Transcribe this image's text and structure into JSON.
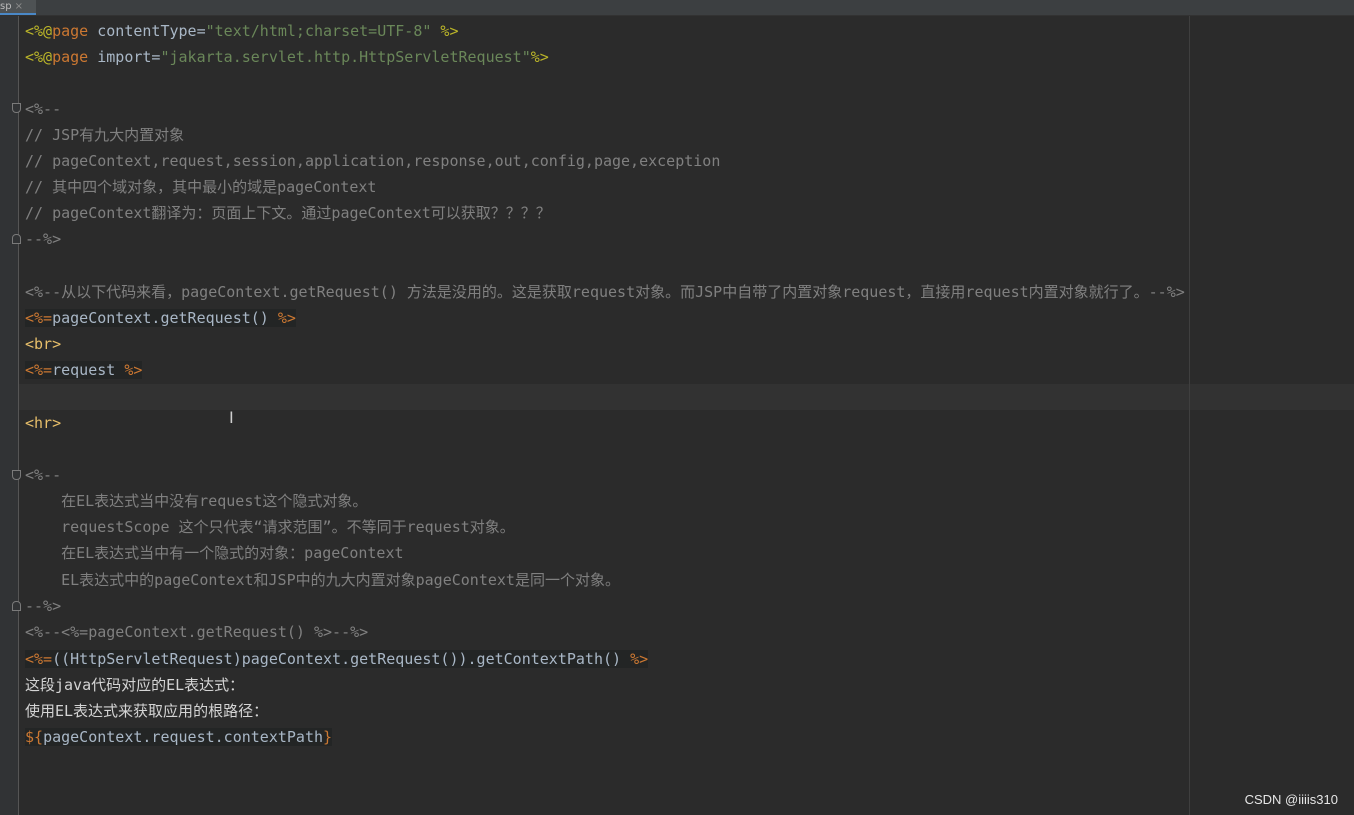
{
  "tab": {
    "label": "sp",
    "close": "×"
  },
  "code": {
    "l1": {
      "a": "<%@",
      "b": "page",
      "c": " contentType=",
      "d": "\"text/html;charset=UTF-8\"",
      "e": " %>"
    },
    "l2": {
      "a": "<%@",
      "b": "page",
      "c": " import=",
      "d": "\"jakarta.servlet.http.HttpServletRequest\"",
      "e": "%>"
    },
    "l4": "<%--",
    "l5": "// JSP有九大内置对象",
    "l6": "// pageContext,request,session,application,response,out,config,page,exception",
    "l7": "// 其中四个域对象，其中最小的域是pageContext",
    "l8": "// pageContext翻译为：页面上下文。通过pageContext可以获取？？？？",
    "l9": "--%>",
    "l11": "<%--从以下代码来看，pageContext.getRequest() 方法是没用的。这是获取request对象。而JSP中自带了内置对象request，直接用request内置对象就行了。--%>",
    "l12": {
      "open": "<%=",
      "body": "pageContext.getRequest() ",
      "close": "%>"
    },
    "l13": "<br>",
    "l14": {
      "open": "<%=",
      "body": "request ",
      "close": "%>"
    },
    "l16": "<hr>",
    "l18": "<%--",
    "l19": "    在EL表达式当中没有request这个隐式对象。",
    "l20": "    requestScope 这个只代表“请求范围”。不等同于request对象。",
    "l21": "    在EL表达式当中有一个隐式的对象：pageContext",
    "l22": "    EL表达式中的pageContext和JSP中的九大内置对象pageContext是同一个对象。",
    "l23": "--%>",
    "l24": "<%--<%=pageContext.getRequest() %>--%>",
    "l25": {
      "open": "<%=",
      "body": "((HttpServletRequest)pageContext.getRequest()).getContextPath() ",
      "close": "%>"
    },
    "l26": "这段java代码对应的EL表达式：",
    "l27": "使用EL表达式来获取应用的根路径：",
    "l28": {
      "open": "${",
      "body": "pageContext.request.contextPath",
      "close": "}"
    }
  },
  "watermark": "CSDN @iiiis310",
  "colors": {
    "background": "#2b2b2b",
    "keyword": "#cc7832",
    "string": "#6a8759",
    "comment": "#808080",
    "tag": "#e8bf6a",
    "text": "#a9b7c6"
  }
}
